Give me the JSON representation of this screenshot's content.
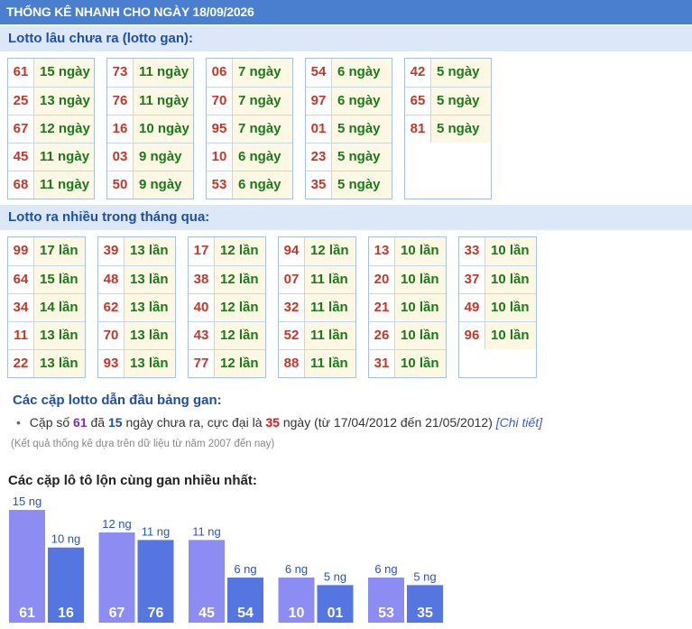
{
  "header": {
    "title": "THỐNG KÊ NHANH CHO NGÀY 18/09/2026"
  },
  "gan": {
    "title": "Lotto lâu chưa ra (lotto gan):",
    "groups": [
      [
        [
          "61",
          "15 ngày"
        ],
        [
          "25",
          "13 ngày"
        ],
        [
          "67",
          "12 ngày"
        ],
        [
          "45",
          "11 ngày"
        ],
        [
          "68",
          "11 ngày"
        ]
      ],
      [
        [
          "73",
          "11 ngày"
        ],
        [
          "76",
          "11 ngày"
        ],
        [
          "16",
          "10 ngày"
        ],
        [
          "03",
          "9 ngày"
        ],
        [
          "50",
          "9 ngày"
        ]
      ],
      [
        [
          "06",
          "7 ngày"
        ],
        [
          "70",
          "7 ngày"
        ],
        [
          "95",
          "7 ngày"
        ],
        [
          "10",
          "6 ngày"
        ],
        [
          "53",
          "6 ngày"
        ]
      ],
      [
        [
          "54",
          "6 ngày"
        ],
        [
          "97",
          "6 ngày"
        ],
        [
          "01",
          "5 ngày"
        ],
        [
          "23",
          "5 ngày"
        ],
        [
          "35",
          "5 ngày"
        ]
      ],
      [
        [
          "42",
          "5 ngày"
        ],
        [
          "65",
          "5 ngày"
        ],
        [
          "81",
          "5 ngày"
        ]
      ]
    ]
  },
  "frequent": {
    "title": "Lotto ra nhiều trong tháng qua:",
    "groups": [
      [
        [
          "99",
          "17 lần"
        ],
        [
          "64",
          "15 lần"
        ],
        [
          "34",
          "14 lần"
        ],
        [
          "11",
          "13 lần"
        ],
        [
          "22",
          "13 lần"
        ]
      ],
      [
        [
          "39",
          "13 lần"
        ],
        [
          "48",
          "13 lần"
        ],
        [
          "62",
          "13 lần"
        ],
        [
          "70",
          "13 lần"
        ],
        [
          "93",
          "13 lần"
        ]
      ],
      [
        [
          "17",
          "12 lần"
        ],
        [
          "38",
          "12 lần"
        ],
        [
          "40",
          "12 lần"
        ],
        [
          "43",
          "12 lần"
        ],
        [
          "77",
          "12 lần"
        ]
      ],
      [
        [
          "94",
          "12 lần"
        ],
        [
          "07",
          "11 lần"
        ],
        [
          "32",
          "11 lần"
        ],
        [
          "52",
          "11 lần"
        ],
        [
          "88",
          "11 lần"
        ]
      ],
      [
        [
          "13",
          "10 lần"
        ],
        [
          "20",
          "10 lần"
        ],
        [
          "21",
          "10 lần"
        ],
        [
          "26",
          "10 lần"
        ],
        [
          "31",
          "10 lần"
        ]
      ],
      [
        [
          "33",
          "10 lần"
        ],
        [
          "37",
          "10 lần"
        ],
        [
          "49",
          "10 lần"
        ],
        [
          "96",
          "10 lần"
        ]
      ]
    ]
  },
  "leaders": {
    "title": "Các cặp lotto dẫn đầu bảng gan:",
    "prefix": "Cặp số",
    "number": "61",
    "mid1": "đã",
    "days": "15",
    "mid2": "ngày chưa ra, cực đại là",
    "max": "35",
    "suffix": "ngày (từ 17/04/2012 đến 21/05/2012)",
    "link": "[Chi tiết]"
  },
  "note": "(Kết quả thống kê dựa trên dữ liệu từ năm 2007 đến nay)",
  "pairs": {
    "title": "Các cặp lô tô lộn cùng gan nhiều nhất:",
    "colors": {
      "first": "#8c8cf2",
      "second": "#5575e0"
    },
    "unit": "ng",
    "items": [
      {
        "a": "61",
        "a_days": 15,
        "b": "16",
        "b_days": 10
      },
      {
        "a": "67",
        "a_days": 12,
        "b": "76",
        "b_days": 11
      },
      {
        "a": "45",
        "a_days": 11,
        "b": "54",
        "b_days": 6
      },
      {
        "a": "10",
        "a_days": 6,
        "b": "01",
        "b_days": 5
      },
      {
        "a": "53",
        "a_days": 6,
        "b": "35",
        "b_days": 5
      }
    ]
  }
}
